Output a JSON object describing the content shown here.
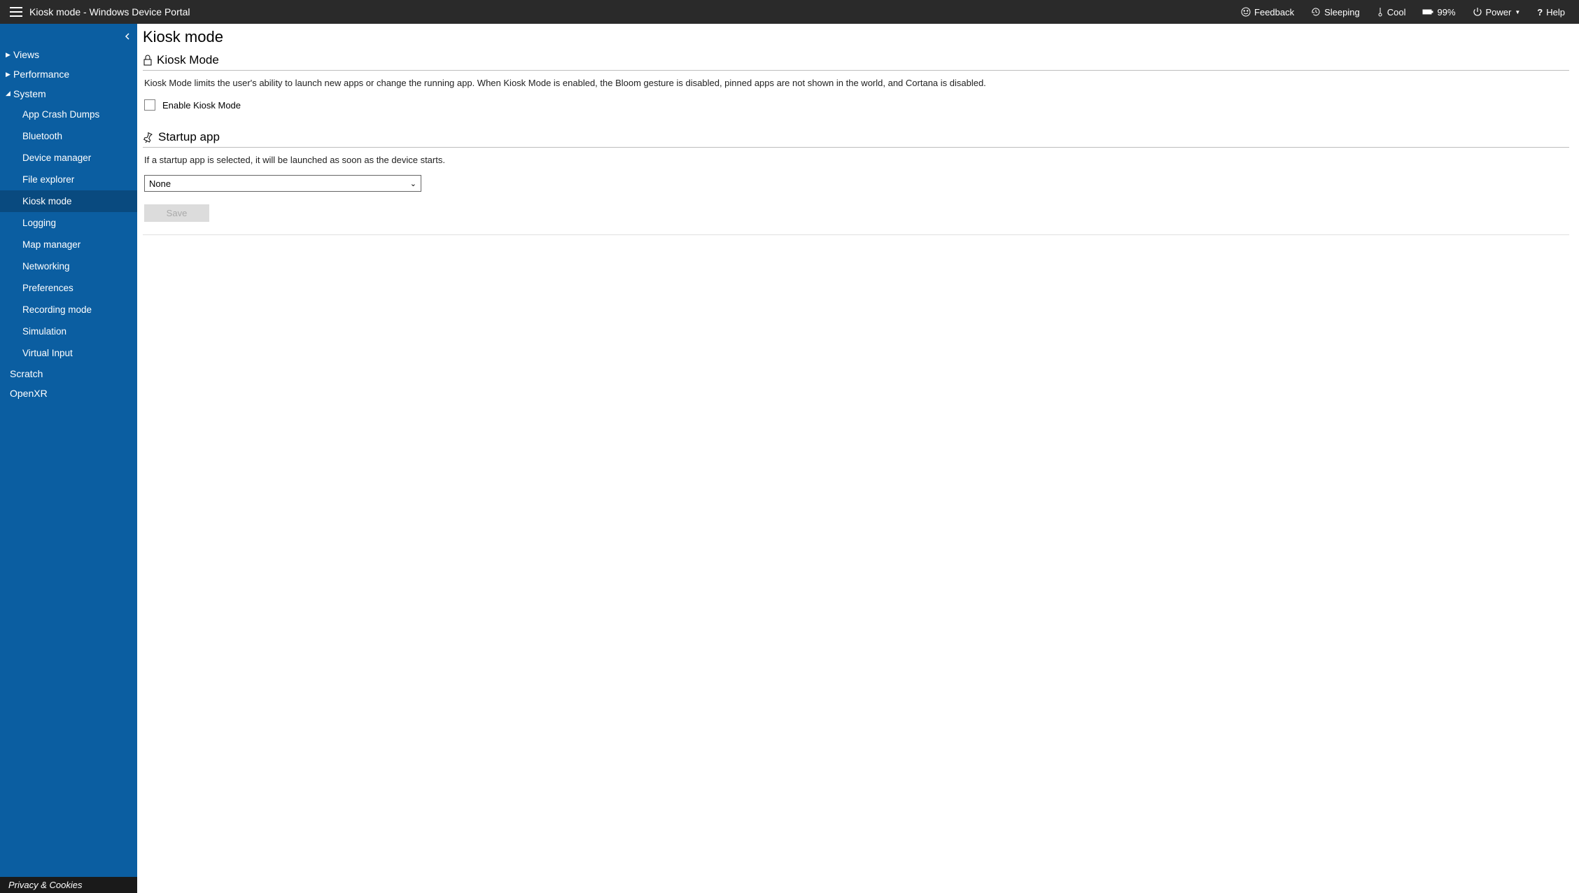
{
  "topbar": {
    "title": "Kiosk mode - Windows Device Portal",
    "feedback": "Feedback",
    "sleeping": "Sleeping",
    "cool": "Cool",
    "battery": "99%",
    "power": "Power",
    "help": "Help"
  },
  "sidebar": {
    "sections": {
      "views": "Views",
      "performance": "Performance",
      "system": "System",
      "scratch": "Scratch",
      "openxr": "OpenXR"
    },
    "system_items": {
      "app_crash": "App Crash Dumps",
      "bluetooth": "Bluetooth",
      "device_manager": "Device manager",
      "file_explorer": "File explorer",
      "kiosk_mode": "Kiosk mode",
      "logging": "Logging",
      "map_manager": "Map manager",
      "networking": "Networking",
      "preferences": "Preferences",
      "recording_mode": "Recording mode",
      "simulation": "Simulation",
      "virtual_input": "Virtual Input"
    },
    "footer": "Privacy & Cookies"
  },
  "main": {
    "page_title": "Kiosk mode",
    "kiosk": {
      "header": "Kiosk Mode",
      "desc": "Kiosk Mode limits the user's ability to launch new apps or change the running app. When Kiosk Mode is enabled, the Bloom gesture is disabled, pinned apps are not shown in the world, and Cortana is disabled.",
      "checkbox_label": "Enable Kiosk Mode"
    },
    "startup": {
      "header": "Startup app",
      "desc": "If a startup app is selected, it will be launched as soon as the device starts.",
      "selected": "None",
      "save": "Save"
    }
  }
}
